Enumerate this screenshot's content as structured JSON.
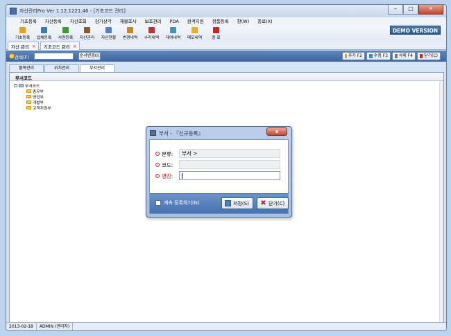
{
  "window": {
    "title": "자산관리Pro Ver 1.12.1221.46 - [기초코드 관리]"
  },
  "menu": [
    "기초등록",
    "자산등록",
    "자산조회",
    "감가상각",
    "재물조사",
    "보조관리",
    "PDA",
    "원격지원",
    "정품등록",
    "창(W)",
    "종료(X)"
  ],
  "toolbar": [
    {
      "label": "기초등록",
      "icon": "folder-icon",
      "color": "#e0a020"
    },
    {
      "label": "업체등록",
      "icon": "company-icon",
      "color": "#3a78c2"
    },
    {
      "label": "사원등록",
      "icon": "user-icon",
      "color": "#3f9b3a"
    },
    {
      "label": "자산관리",
      "icon": "asset-icon",
      "color": "#8a5a2c"
    },
    {
      "label": "자산현황",
      "icon": "report-icon",
      "color": "#5b7fb0"
    },
    {
      "label": "변경내역",
      "icon": "edit-icon",
      "color": "#c08a20"
    },
    {
      "label": "수리내역",
      "icon": "wrench-icon",
      "color": "#b03a3a"
    },
    {
      "label": "대여내역",
      "icon": "lend-icon",
      "color": "#4a90b0"
    },
    {
      "label": "메모내역",
      "icon": "memo-icon",
      "color": "#e0b030"
    },
    {
      "label": "종 료",
      "icon": "exit-icon",
      "color": "#d02020"
    }
  ],
  "demo_badge": "DEMO VERSION",
  "doc_tabs": [
    {
      "label": "자산 관리",
      "closable": true
    },
    {
      "label": "기초코드 관리",
      "closable": true
    }
  ],
  "search": {
    "label": "검색(F)",
    "value": "",
    "order_button": "순서변경(I)"
  },
  "actions": [
    {
      "label": "추가 F2",
      "icon": "add-icon",
      "color": "#e0a020"
    },
    {
      "label": "수정 F3",
      "icon": "edit-icon",
      "color": "#4a7fc0"
    },
    {
      "label": "삭제 F4",
      "icon": "delete-icon",
      "color": "#7a7a7a"
    },
    {
      "label": "닫기(C)",
      "icon": "close-icon",
      "color": "#d02020"
    }
  ],
  "sub_tabs": [
    {
      "label": "품목관리",
      "active": false
    },
    {
      "label": "위치관리",
      "active": false
    },
    {
      "label": "부서관리",
      "active": true
    }
  ],
  "tree": {
    "header": "부서코드",
    "root": "부서코드",
    "children": [
      "총무부",
      "영업부",
      "개발부",
      "고객지원부"
    ]
  },
  "status": [
    "2013-02-18",
    "ADMIN (관리자)"
  ],
  "dialog": {
    "title": "부서 - 『신규등록』",
    "close": "x",
    "fields": [
      {
        "label": "분류:",
        "value": "부서 >",
        "required": false,
        "editable": false
      },
      {
        "label": "코드:",
        "value": "",
        "required": false,
        "editable": false
      },
      {
        "label": "명칭:",
        "value": "",
        "required": true,
        "editable": true
      }
    ],
    "keep_label": "계속 등록하기(N)",
    "save_label": "저장(S)",
    "close_label": "닫기(C)"
  }
}
